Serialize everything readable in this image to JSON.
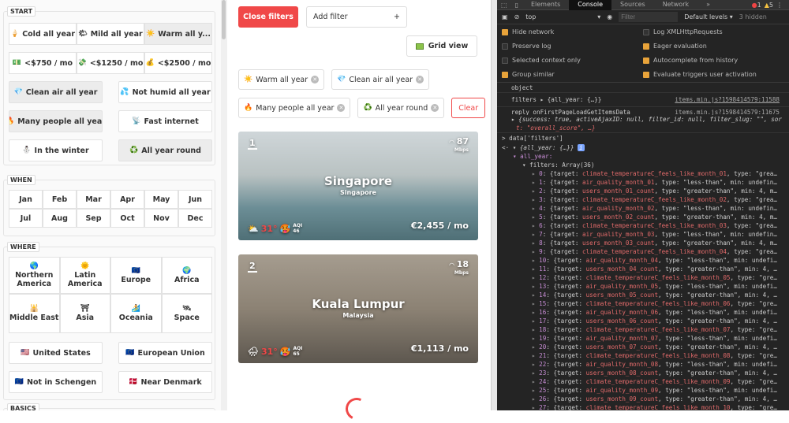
{
  "left": {
    "start": {
      "label": "START",
      "rows": [
        [
          {
            "icon": "🍦",
            "label": "Cold all year",
            "on": false
          },
          {
            "icon": "🌤",
            "label": "Mild all year",
            "on": false
          },
          {
            "icon": "☀️",
            "label": "Warm all y...",
            "on": true
          }
        ],
        [
          {
            "icon": "💵",
            "label": "<$750 / mo",
            "on": false
          },
          {
            "icon": "💸",
            "label": "<$1250 / mo",
            "on": false
          },
          {
            "icon": "💰",
            "label": "<$2500 / mo",
            "on": false
          }
        ],
        [
          {
            "icon": "💎",
            "label": "Clean air all year",
            "on": true
          },
          {
            "icon": "💦",
            "label": "Not humid all year",
            "on": false
          }
        ],
        [
          {
            "icon": "🔥",
            "label": "Many people all year",
            "on": true
          },
          {
            "icon": "📡",
            "label": "Fast internet",
            "on": false
          }
        ],
        [
          {
            "icon": "⛄",
            "label": "In the winter",
            "on": false
          },
          {
            "icon": "♻️",
            "label": "All year round",
            "on": true
          }
        ]
      ]
    },
    "when": {
      "label": "WHEN",
      "months": [
        "Jan",
        "Feb",
        "Mar",
        "Apr",
        "May",
        "Jun",
        "Jul",
        "Aug",
        "Sep",
        "Oct",
        "Nov",
        "Dec"
      ]
    },
    "where": {
      "label": "WHERE",
      "regions": [
        {
          "icon": "🌎",
          "label": "Northern America"
        },
        {
          "icon": "🌞",
          "label": "Latin America"
        },
        {
          "icon": "🇪🇺",
          "label": "Europe"
        },
        {
          "icon": "🌍",
          "label": "Africa"
        },
        {
          "icon": "🕌",
          "label": "Middle East"
        },
        {
          "icon": "⛩",
          "label": "Asia"
        },
        {
          "icon": "🏄",
          "label": "Oceania"
        },
        {
          "icon": "🛰",
          "label": "Space"
        }
      ],
      "rows": [
        [
          {
            "icon": "🇺🇸",
            "label": "United States"
          },
          {
            "icon": "🇪🇺",
            "label": "European Union"
          }
        ],
        [
          {
            "icon": "🇪🇺",
            "label": "Not in Schengen"
          },
          {
            "icon": "🇩🇰",
            "label": "Near Denmark"
          }
        ]
      ]
    },
    "basics": {
      "label": "BASICS"
    }
  },
  "mid": {
    "close_filters": "Close filters",
    "add_filter": "Add filter",
    "add_icon": "+",
    "grid_view": "Grid view",
    "chips": [
      {
        "icon": "☀️",
        "label": "Warm all year"
      },
      {
        "icon": "💎",
        "label": "Clean air all year"
      },
      {
        "icon": "🔥",
        "label": "Many people all year"
      },
      {
        "icon": "♻️",
        "label": "All year round"
      }
    ],
    "clear": "Clear",
    "cards": [
      {
        "rank": "1",
        "city": "Singapore",
        "country": "Singapore",
        "speed": "87",
        "unit": "Mbps",
        "price": "€2,455 / mo",
        "weather": "⛅",
        "temp": "31°",
        "aqi_icon": "🥵",
        "aqi_label": "AQI",
        "aqi": "46"
      },
      {
        "rank": "2",
        "city": "Kuala Lumpur",
        "country": "Malaysia",
        "speed": "18",
        "unit": "Mbps",
        "price": "€1,113 / mo",
        "weather": "🌧",
        "temp": "31°",
        "aqi_icon": "🥵",
        "aqi_label": "AQI",
        "aqi": "65"
      }
    ]
  },
  "dev": {
    "tabs": [
      "Elements",
      "Console",
      "Sources",
      "Network",
      "»"
    ],
    "errors": "1",
    "warnings": "5",
    "context": "top",
    "filter_placeholder": "Filter",
    "levels": "Default levels ▾",
    "hidden": "3 hidden",
    "options": [
      {
        "label": "Hide network",
        "on": true
      },
      {
        "label": "Log XMLHttpRequests",
        "on": false
      },
      {
        "label": "Preserve log",
        "on": false
      },
      {
        "label": "Eager evaluation",
        "on": true
      },
      {
        "label": "Selected context only",
        "on": false
      },
      {
        "label": "Autocomplete from history",
        "on": true
      },
      {
        "label": "Group similar",
        "on": true
      },
      {
        "label": "Evaluate triggers user activation",
        "on": true
      }
    ],
    "log": {
      "object": "object",
      "filters_line": "filters ▸ {all_year: {…}}",
      "filters_src": "items.min.js?1598414579:11588",
      "reply_line": "reply onFirstPageLoadGetItemsData",
      "reply_src": "items.min.js?1598414579:11675",
      "reply_obj1": "▸ {success: true, activeAjaxID: null, filter_id: null, filter_slug: \"\", sor",
      "reply_obj2": "t: \"overall_score\", …}",
      "input": "> data['filters']",
      "result": "<· ▾ {all_year: {…}}",
      "all_year": "▾ all_year:",
      "filters_arr": "▾ filters: Array(36)"
    },
    "filters": [
      [
        "0",
        "climate_temperatureC_feels_like_month_01",
        "type: \"grea…"
      ],
      [
        "1",
        "air_quality_month_01",
        "type: \"less-than\", min: undefin…"
      ],
      [
        "2",
        "users_month_01_count",
        "type: \"greater-than\", min: 4, m…"
      ],
      [
        "3",
        "climate_temperatureC_feels_like_month_02",
        "type: \"grea…"
      ],
      [
        "4",
        "air_quality_month_02",
        "type: \"less-than\", min: undefin…"
      ],
      [
        "5",
        "users_month_02_count",
        "type: \"greater-than\", min: 4, m…"
      ],
      [
        "6",
        "climate_temperatureC_feels_like_month_03",
        "type: \"grea…"
      ],
      [
        "7",
        "air_quality_month_03",
        "type: \"less-than\", min: undefin…"
      ],
      [
        "8",
        "users_month_03_count",
        "type: \"greater-than\", min: 4, m…"
      ],
      [
        "9",
        "climate_temperatureC_feels_like_month_04",
        "type: \"grea…"
      ],
      [
        "10",
        "air_quality_month_04",
        "type: \"less-than\", min: undefi…"
      ],
      [
        "11",
        "users_month_04_count",
        "type: \"greater-than\", min: 4, …"
      ],
      [
        "12",
        "climate_temperatureC_feels_like_month_05",
        "type: \"gre…"
      ],
      [
        "13",
        "air_quality_month_05",
        "type: \"less-than\", min: undefi…"
      ],
      [
        "14",
        "users_month_05_count",
        "type: \"greater-than\", min: 4, …"
      ],
      [
        "15",
        "climate_temperatureC_feels_like_month_06",
        "type: \"gre…"
      ],
      [
        "16",
        "air_quality_month_06",
        "type: \"less-than\", min: undefi…"
      ],
      [
        "17",
        "users_month_06_count",
        "type: \"greater-than\", min: 4, …"
      ],
      [
        "18",
        "climate_temperatureC_feels_like_month_07",
        "type: \"gre…"
      ],
      [
        "19",
        "air_quality_month_07",
        "type: \"less-than\", min: undefi…"
      ],
      [
        "20",
        "users_month_07_count",
        "type: \"greater-than\", min: 4, …"
      ],
      [
        "21",
        "climate_temperatureC_feels_like_month_08",
        "type: \"gre…"
      ],
      [
        "22",
        "air_quality_month_08",
        "type: \"less-than\", min: undefi…"
      ],
      [
        "23",
        "users_month_08_count",
        "type: \"greater-than\", min: 4, …"
      ],
      [
        "24",
        "climate_temperatureC_feels_like_month_09",
        "type: \"gre…"
      ],
      [
        "25",
        "air_quality_month_09",
        "type: \"less-than\", min: undefi…"
      ],
      [
        "26",
        "users_month_09_count",
        "type: \"greater-than\", min: 4, …"
      ],
      [
        "27",
        "climate_temperatureC_feels_like_month_10",
        "type: \"gre…"
      ]
    ]
  }
}
